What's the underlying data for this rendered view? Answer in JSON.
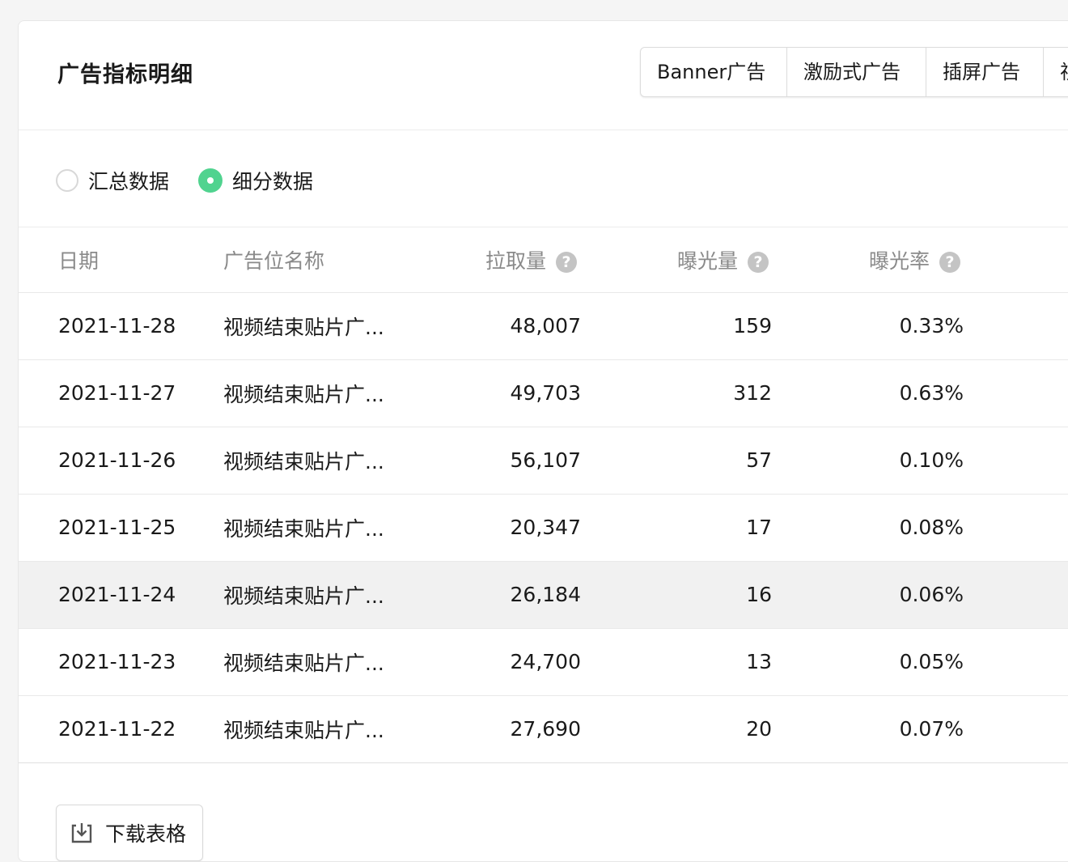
{
  "header": {
    "title": "广告指标明细",
    "tabs": [
      "Banner广告",
      "激励式广告",
      "插屏广告",
      "视"
    ]
  },
  "mode": {
    "options": [
      "汇总数据",
      "细分数据"
    ],
    "selected": "细分数据"
  },
  "table": {
    "columns": [
      "日期",
      "广告位名称",
      "拉取量",
      "曝光量",
      "曝光率"
    ],
    "rows": [
      {
        "date": "2021-11-28",
        "name": "视频结束贴片广...",
        "pull": "48,007",
        "exposure": "159",
        "rate": "0.33%"
      },
      {
        "date": "2021-11-27",
        "name": "视频结束贴片广...",
        "pull": "49,703",
        "exposure": "312",
        "rate": "0.63%"
      },
      {
        "date": "2021-11-26",
        "name": "视频结束贴片广...",
        "pull": "56,107",
        "exposure": "57",
        "rate": "0.10%"
      },
      {
        "date": "2021-11-25",
        "name": "视频结束贴片广...",
        "pull": "20,347",
        "exposure": "17",
        "rate": "0.08%"
      },
      {
        "date": "2021-11-24",
        "name": "视频结束贴片广...",
        "pull": "26,184",
        "exposure": "16",
        "rate": "0.06%"
      },
      {
        "date": "2021-11-23",
        "name": "视频结束贴片广...",
        "pull": "24,700",
        "exposure": "13",
        "rate": "0.05%"
      },
      {
        "date": "2021-11-22",
        "name": "视频结束贴片广...",
        "pull": "27,690",
        "exposure": "20",
        "rate": "0.07%"
      }
    ]
  },
  "download": {
    "label": "下载表格",
    "icon": "download-icon"
  },
  "colors": {
    "accent": "#07c160",
    "highlight_row": "#f1f1f1"
  }
}
